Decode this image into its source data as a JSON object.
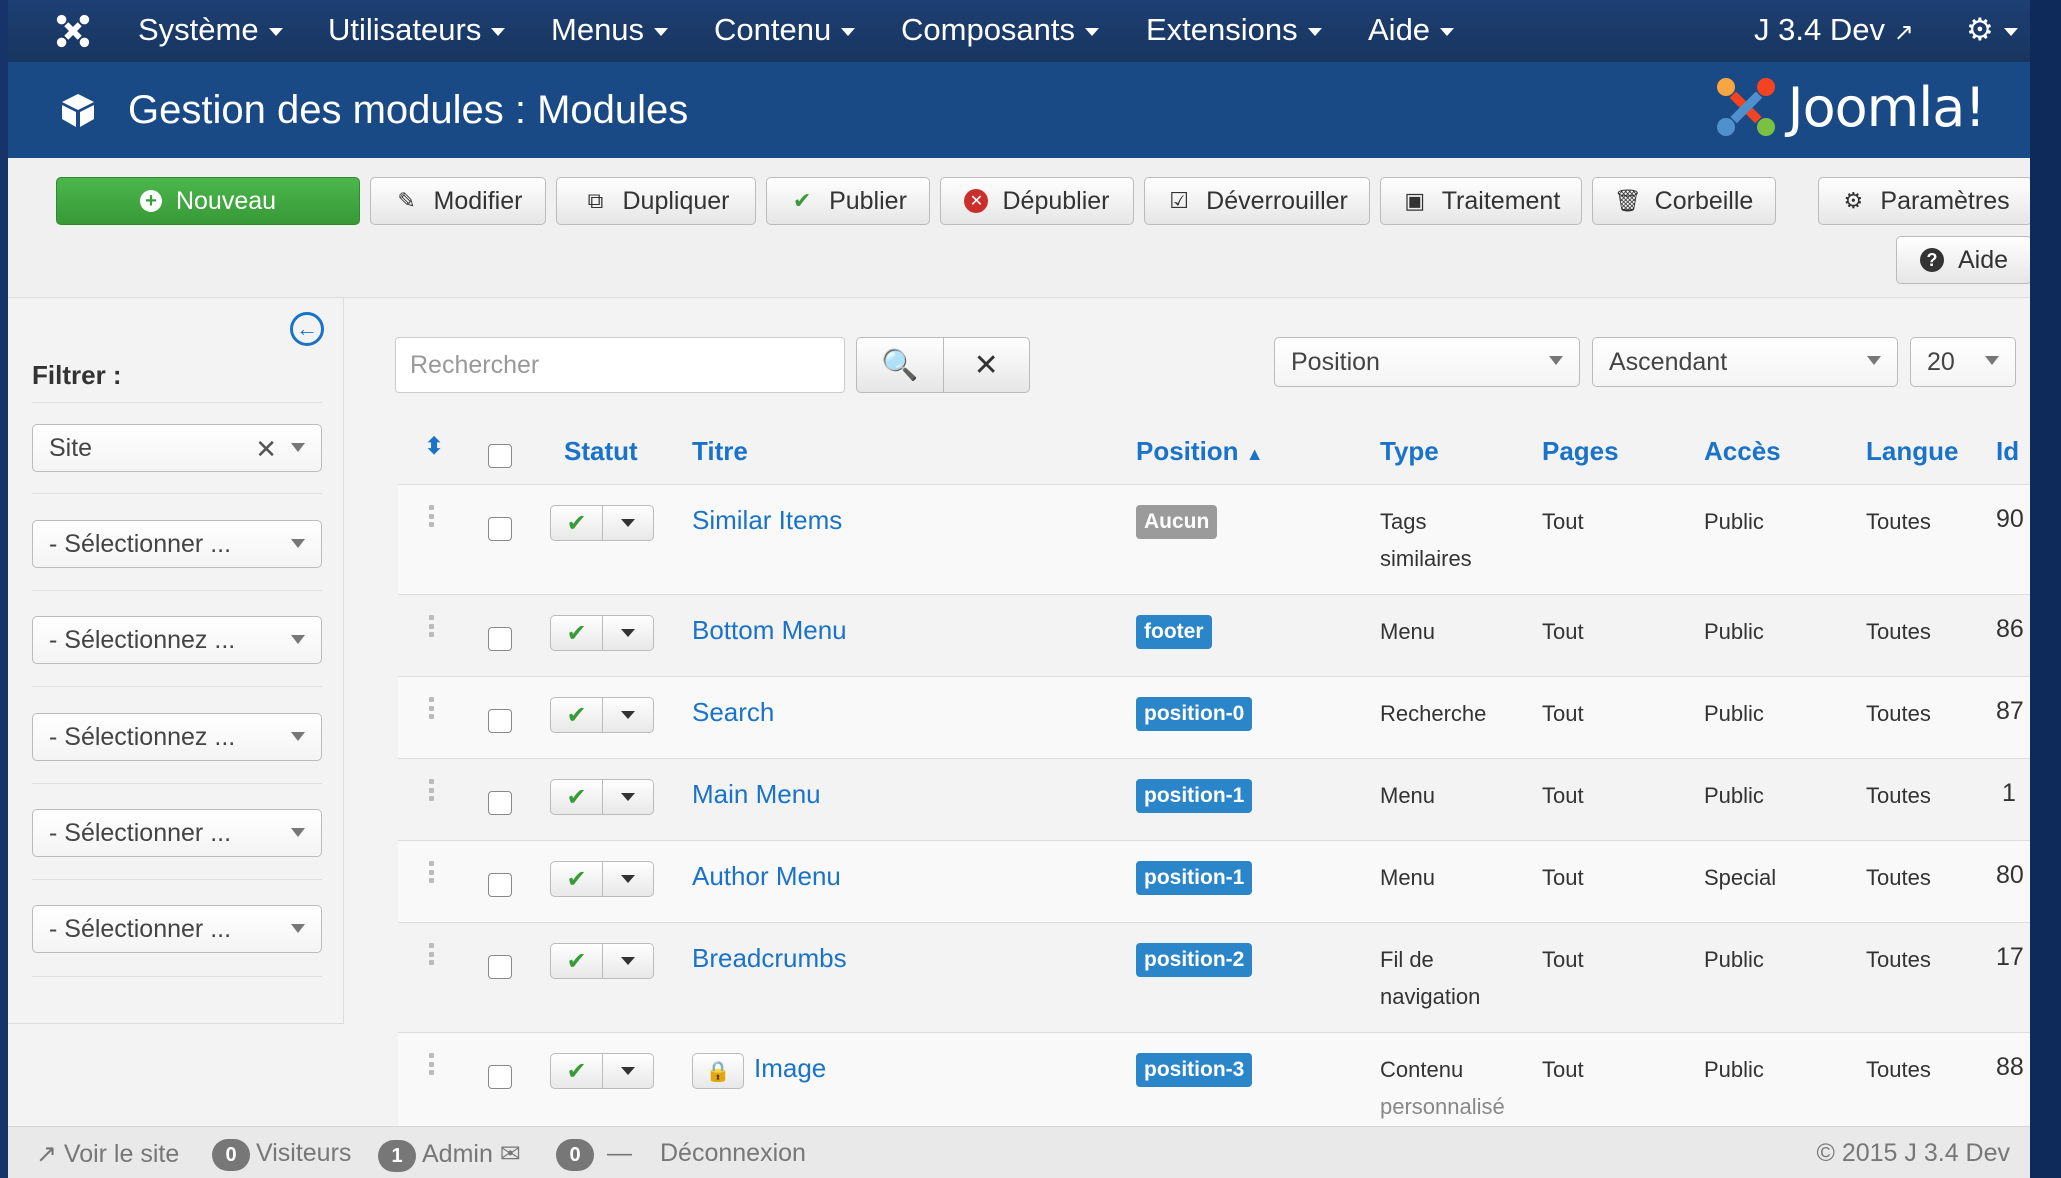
{
  "navbar": {
    "logo_icon": "joomla-x-icon",
    "items": [
      {
        "label": "Système"
      },
      {
        "label": "Utilisateurs"
      },
      {
        "label": "Menus"
      },
      {
        "label": "Contenu"
      },
      {
        "label": "Composants"
      },
      {
        "label": "Extensions"
      },
      {
        "label": "Aide"
      }
    ],
    "site_link": "J 3.4 Dev",
    "settings_icon": "gear-icon"
  },
  "titlebar": {
    "title": "Gestion des modules : Modules",
    "title_icon": "cube-icon",
    "brand": "Joomla!"
  },
  "toolbar": {
    "new": "Nouveau",
    "edit": "Modifier",
    "duplicate": "Dupliquer",
    "publish": "Publier",
    "unpublish": "Dépublier",
    "checkin": "Déverrouiller",
    "batch": "Traitement",
    "trash": "Corbeille",
    "options": "Paramètres",
    "help": "Aide"
  },
  "sidebar": {
    "filter_label": "Filtrer :",
    "filters": [
      {
        "value": "Site"
      },
      {
        "value": "- Sélectionner ..."
      },
      {
        "value": "- Sélectionnez ..."
      },
      {
        "value": "- Sélectionnez ..."
      },
      {
        "value": "- Sélectionner ..."
      },
      {
        "value": "- Sélectionner ..."
      }
    ]
  },
  "search": {
    "placeholder": "Rechercher",
    "sort_field": "Position",
    "sort_direction": "Ascendant",
    "limit": "20"
  },
  "table": {
    "headers": {
      "status": "Statut",
      "title": "Titre",
      "position": "Position",
      "type": "Type",
      "pages": "Pages",
      "access": "Accès",
      "language": "Langue",
      "id": "Id"
    },
    "rows": [
      {
        "title": "Similar Items",
        "position": "Aucun",
        "type1": "Tags",
        "type2": "similaires",
        "pages": "Tout",
        "access": "Public",
        "language": "Toutes",
        "id": "90",
        "locked": false
      },
      {
        "title": "Bottom Menu",
        "position": "footer",
        "type1": "Menu",
        "type2": "",
        "pages": "Tout",
        "access": "Public",
        "language": "Toutes",
        "id": "86",
        "locked": false
      },
      {
        "title": "Search",
        "position": "position-0",
        "type1": "Recherche",
        "type2": "",
        "pages": "Tout",
        "access": "Public",
        "language": "Toutes",
        "id": "87",
        "locked": false
      },
      {
        "title": "Main Menu",
        "position": "position-1",
        "type1": "Menu",
        "type2": "",
        "pages": "Tout",
        "access": "Public",
        "language": "Toutes",
        "id": "1",
        "locked": false
      },
      {
        "title": "Author Menu",
        "position": "position-1",
        "type1": "Menu",
        "type2": "",
        "pages": "Tout",
        "access": "Special",
        "language": "Toutes",
        "id": "80",
        "locked": false
      },
      {
        "title": "Breadcrumbs",
        "position": "position-2",
        "type1": "Fil de",
        "type2": "navigation",
        "pages": "Tout",
        "access": "Public",
        "language": "Toutes",
        "id": "17",
        "locked": false
      },
      {
        "title": "Image",
        "position": "position-3",
        "type1": "Contenu",
        "type2": "personnalisé",
        "pages": "Tout",
        "access": "Public",
        "language": "Toutes",
        "id": "88",
        "locked": true
      }
    ]
  },
  "footer": {
    "view_site": "Voir le site",
    "visitors_count": "0",
    "visitors": "Visiteurs",
    "admin_count": "1",
    "admin": "Admin",
    "messages_count": "0",
    "logout": "Déconnexion",
    "copyright": "© 2015 J 3.4 Dev"
  }
}
